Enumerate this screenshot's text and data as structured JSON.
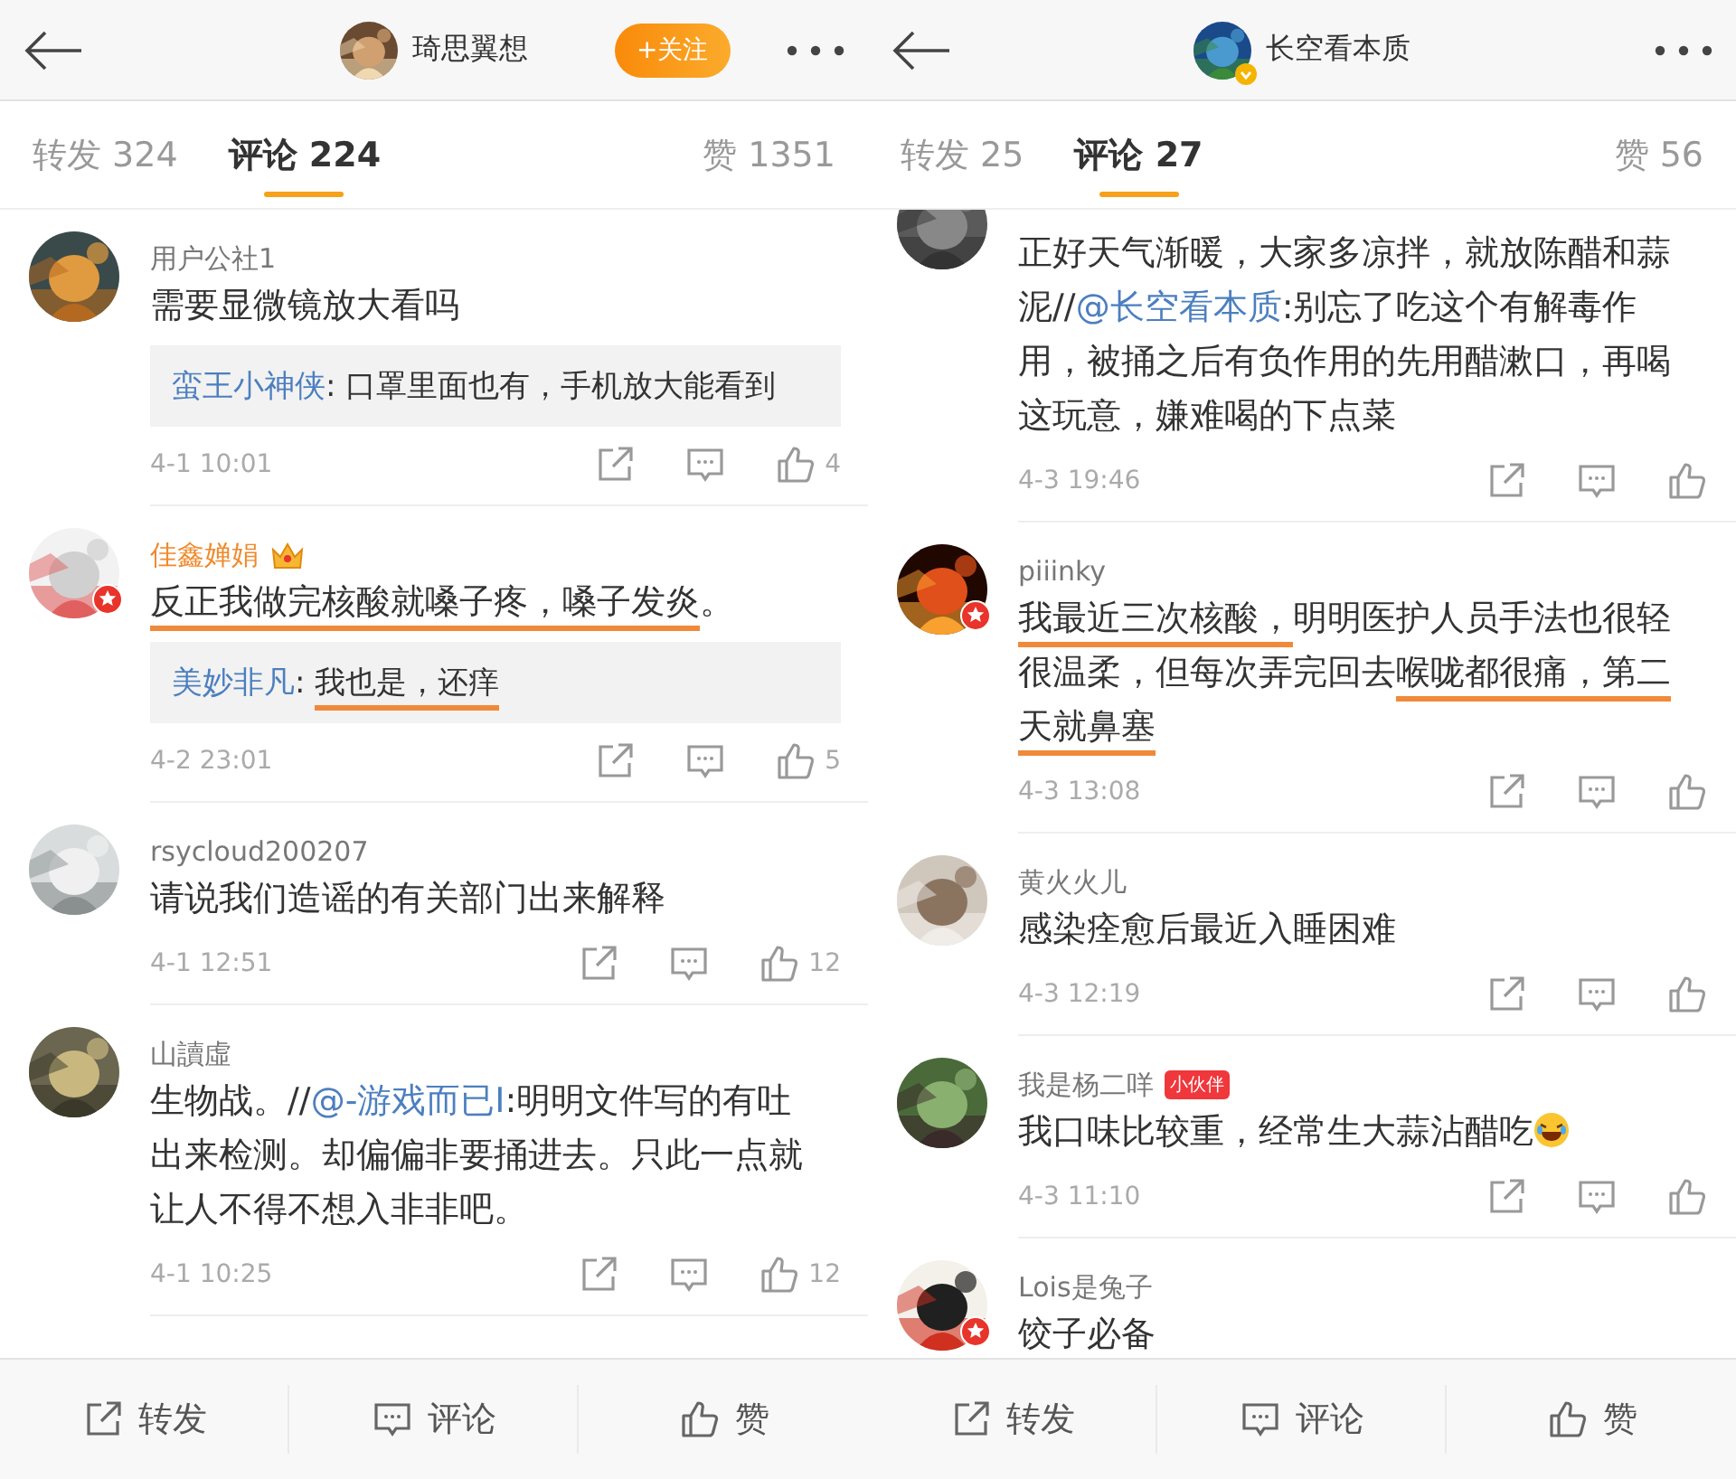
{
  "screens": [
    {
      "header": {
        "title": "琦思翼想",
        "follow_button": "+关注"
      },
      "tabs": [
        {
          "label": "转发 324",
          "selected": false
        },
        {
          "label": "评论 224",
          "selected": true
        },
        {
          "label": "赞 1351",
          "selected": false
        }
      ],
      "comments": [
        {
          "author": "用户公社1",
          "body": [
            {
              "kind": "plain",
              "text": "需要显微镜放大看吗"
            }
          ],
          "reply": {
            "author": "蛮王小神侠",
            "body": [
              {
                "kind": "plain",
                "text": ": 口罩里面也有，手机放大能看到"
              }
            ]
          },
          "time": "4-1 10:01",
          "likes": "4"
        },
        {
          "author": "佳鑫婵娟",
          "vip": true,
          "crown": true,
          "badge": true,
          "body": [
            {
              "kind": "underlined",
              "text": "反正我做完核酸就嗓子疼，嗓子发炎"
            },
            {
              "kind": "plain",
              "text": "。"
            }
          ],
          "reply": {
            "author": "美妙非凡",
            "body": [
              {
                "kind": "plain",
                "text": ": "
              },
              {
                "kind": "underlined",
                "text": "我也是，还痒"
              }
            ]
          },
          "time": "4-2 23:01",
          "likes": "5"
        },
        {
          "author": "rsycloud200207",
          "body": [
            {
              "kind": "plain",
              "text": "请说我们造谣的有关部门出来解释"
            }
          ],
          "time": "4-1 12:51",
          "likes": "12"
        },
        {
          "author": "山讀虛",
          "body": [
            {
              "kind": "plain",
              "text": "生物战。//"
            },
            {
              "kind": "mention",
              "text": "@-游戏而已I"
            },
            {
              "kind": "plain",
              "text": ":明明文件写的有吐出来检测。却偏偏非要捅进去。只此一点就让人不得不想入非非吧。"
            }
          ],
          "time": "4-1 10:25",
          "likes": "12"
        }
      ],
      "bottom_bar": [
        "转发",
        "评论",
        "赞"
      ]
    },
    {
      "header": {
        "title": "长空看本质",
        "verified": true
      },
      "tabs": [
        {
          "label": "转发 25",
          "selected": false
        },
        {
          "label": "评论 27",
          "selected": true
        },
        {
          "label": "赞 56",
          "selected": false
        }
      ],
      "comments": [
        {
          "body": [
            {
              "kind": "plain",
              "text": "正好天气渐暖，大家多凉拌，就放陈醋和蒜泥//"
            },
            {
              "kind": "mention",
              "text": "@长空看本质"
            },
            {
              "kind": "plain",
              "text": ":别忘了吃这个有解毒作用，被捅之后有负作用的先用醋漱口，再喝这玩意，嫌难喝的下点菜"
            }
          ],
          "time": "4-3 19:46"
        },
        {
          "author": "piiinky",
          "badge": true,
          "body": [
            {
              "kind": "underlined",
              "text": "我最近三次核酸，"
            },
            {
              "kind": "plain",
              "text": "明明医护人员手法也很轻很温柔，但每次弄完回去"
            },
            {
              "kind": "underlined",
              "text": "喉咙都很痛，第二天就鼻塞"
            }
          ],
          "time": "4-3 13:08"
        },
        {
          "author": "黄火火儿",
          "body": [
            {
              "kind": "plain",
              "text": "感染痊愈后最近入睡困难"
            }
          ],
          "time": "4-3 12:19"
        },
        {
          "author": "我是杨二咩",
          "tag": "小伙伴",
          "body": [
            {
              "kind": "plain",
              "text": "我口味比较重，经常生大蒜沾醋吃"
            },
            {
              "kind": "emoji"
            }
          ],
          "time": "4-3 11:10"
        },
        {
          "author": "Lois是兔子",
          "badge": true,
          "body": [
            {
              "kind": "plain",
              "text": "饺子必备"
            }
          ]
        }
      ],
      "bottom_bar": [
        "转发",
        "评论",
        "赞"
      ]
    }
  ]
}
